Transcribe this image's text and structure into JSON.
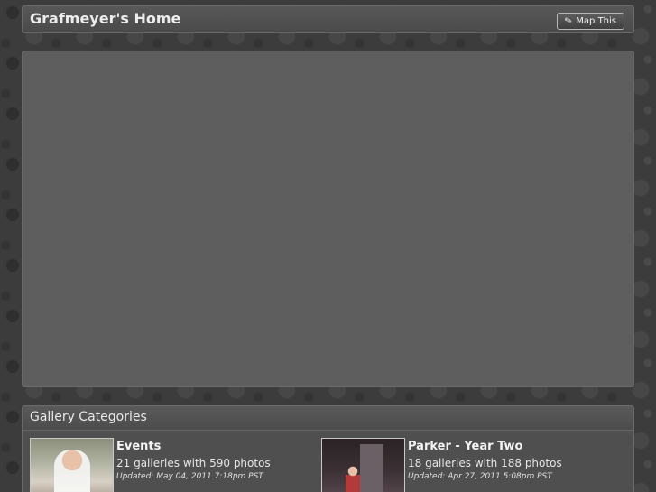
{
  "header": {
    "title": "Grafmeyer's Home",
    "map_button_label": "Map This"
  },
  "gallery": {
    "title": "Gallery Categories",
    "items": [
      {
        "name": "Events",
        "count": "21 galleries with 590 photos",
        "updated": "Updated: May 04, 2011 7:18pm PST"
      },
      {
        "name": "Parker - Year Two",
        "count": "18 galleries with 188 photos",
        "updated": "Updated: Apr 27, 2011 5:08pm PST"
      }
    ]
  },
  "icons": {
    "map_button": "pin-icon"
  }
}
